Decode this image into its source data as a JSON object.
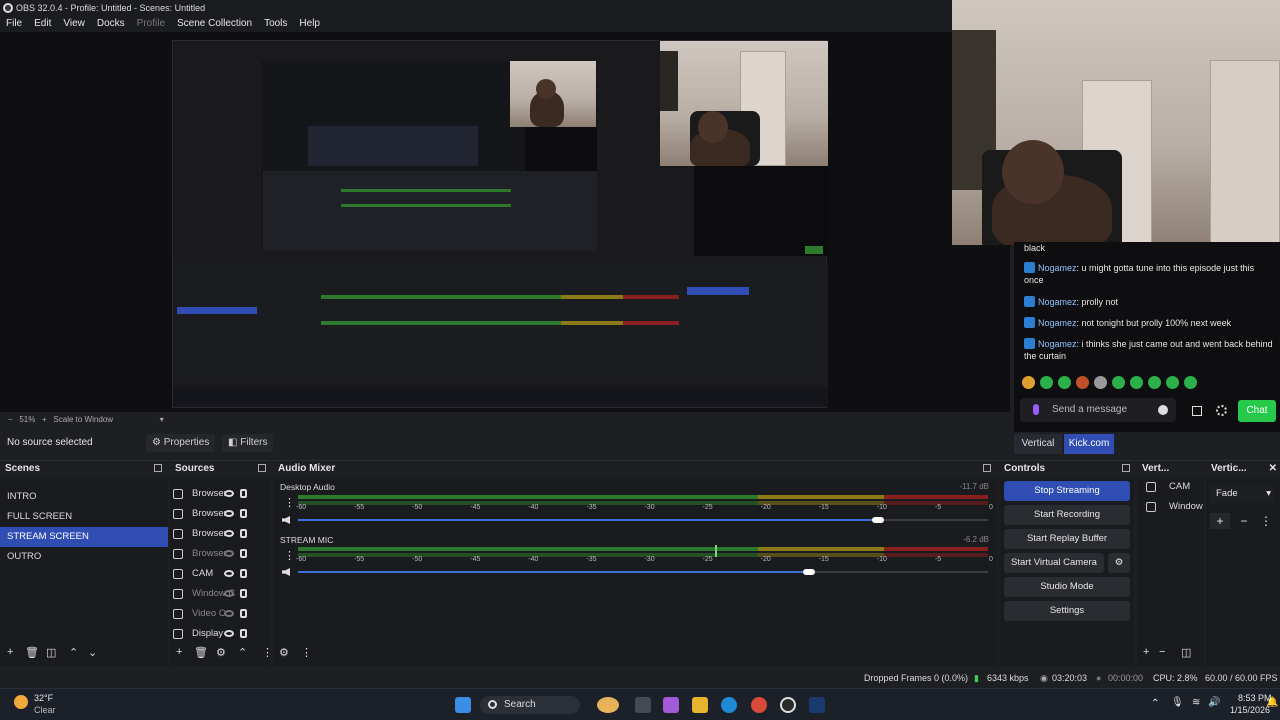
{
  "window": {
    "title": "OBS 32.0.4 - Profile: Untitled - Scenes: Untitled"
  },
  "menu": [
    "File",
    "Edit",
    "View",
    "Docks",
    "Profile",
    "Scene Collection",
    "Tools",
    "Help"
  ],
  "preview": {
    "zoom": "51%",
    "scale_mode": "Scale to Window"
  },
  "context": {
    "no_source": "No source selected",
    "properties": "Properties",
    "filters": "Filters"
  },
  "chat": {
    "partial_line": "black",
    "messages": [
      {
        "user": "Nogamez",
        "text": ": u might gotta tune into this episode just this once"
      },
      {
        "user": "Nogamez",
        "text": ": prolly not"
      },
      {
        "user": "Nogamez",
        "text": ": not tonight but prolly 100% next week"
      },
      {
        "user": "Nogamez",
        "text": ": i thinks she just came out and went back behind the curtain"
      }
    ],
    "placeholder": "Send a message",
    "send_label": "Chat",
    "tabs": [
      "Vertical",
      "Kick.com"
    ]
  },
  "scenes": {
    "title": "Scenes",
    "items": [
      "INTRO",
      "FULL SCREEN",
      "STREAM SCREEN",
      "OUTRO"
    ],
    "selected": "STREAM SCREEN"
  },
  "sources": {
    "title": "Sources",
    "items": [
      {
        "name": "Browser",
        "icon": "globe-icon",
        "visible": true
      },
      {
        "name": "Browser",
        "icon": "globe-icon",
        "visible": true
      },
      {
        "name": "Browser",
        "icon": "globe-icon",
        "visible": true
      },
      {
        "name": "Browser",
        "icon": "globe-icon",
        "visible": false
      },
      {
        "name": "CAM",
        "icon": "camera-icon",
        "visible": true
      },
      {
        "name": "Window C",
        "icon": "window-icon",
        "visible": false
      },
      {
        "name": "Video C",
        "icon": "video-icon",
        "visible": false
      },
      {
        "name": "Display",
        "icon": "display-icon",
        "visible": true
      }
    ]
  },
  "mixer": {
    "title": "Audio Mixer",
    "ticks": [
      "-60",
      "-55",
      "-50",
      "-45",
      "-40",
      "-35",
      "-30",
      "-25",
      "-20",
      "-15",
      "-10",
      "-5",
      "0"
    ],
    "channels": [
      {
        "name": "Desktop Audio",
        "db": "-11.7 dB",
        "volume": 0.84
      },
      {
        "name": "STREAM MIC",
        "db": "-6.2 dB",
        "volume": 0.74
      }
    ]
  },
  "controls": {
    "title": "Controls",
    "buttons": [
      "Stop Streaming",
      "Start Recording",
      "Start Replay Buffer",
      "Start Virtual Camera",
      "Studio Mode",
      "Settings"
    ]
  },
  "vertical_sources": {
    "title": "Vert...",
    "items": [
      "CAM",
      "Window C"
    ]
  },
  "vertical_transitions": {
    "title": "Vertic...",
    "transition": "Fade"
  },
  "status": {
    "dropped": "Dropped Frames 0 (0.0%)",
    "bitrate": "6343 kbps",
    "stream_time": "03:20:03",
    "rec_time": "00:00:00",
    "cpu": "CPU: 2.8%",
    "fps": "60.00 / 60.00 FPS"
  },
  "taskbar": {
    "weather_temp": "32°F",
    "weather_desc": "Clear",
    "search": "Search",
    "time": "8:53 PM",
    "date": "1/15/2026"
  }
}
